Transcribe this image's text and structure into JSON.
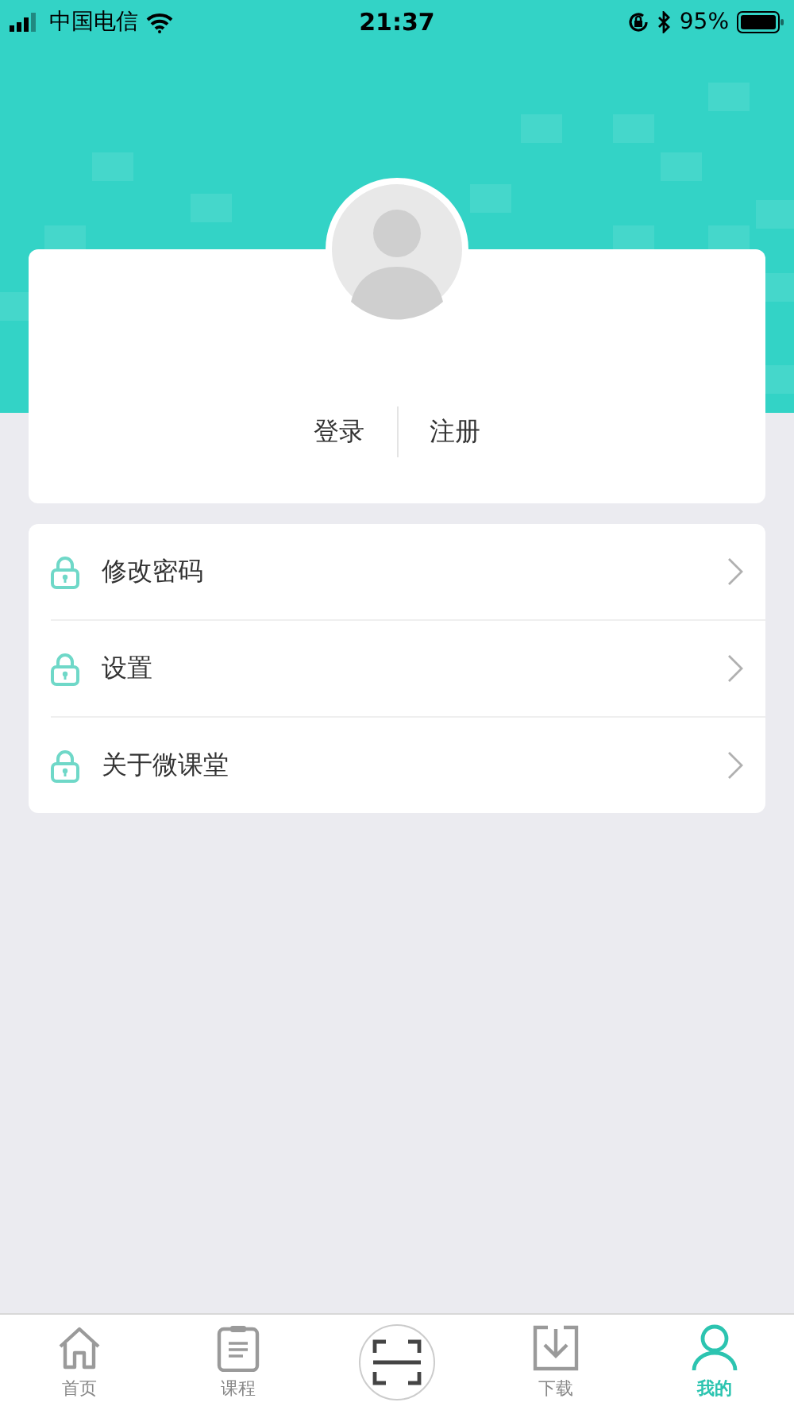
{
  "status_bar": {
    "carrier": "中国电信",
    "time": "21:37",
    "battery": "95%"
  },
  "account": {
    "login": "登录",
    "register": "注册"
  },
  "menu": [
    {
      "label": "修改密码"
    },
    {
      "label": "设置"
    },
    {
      "label": "关于微课堂"
    }
  ],
  "tab_bar": [
    {
      "kind": "home",
      "label": "首页",
      "selected": false
    },
    {
      "kind": "course",
      "label": "课程",
      "selected": false
    },
    {
      "kind": "scan",
      "selected": false
    },
    {
      "kind": "download",
      "label": "下载",
      "selected": false
    },
    {
      "kind": "profile",
      "label": "我的",
      "selected": true
    }
  ]
}
